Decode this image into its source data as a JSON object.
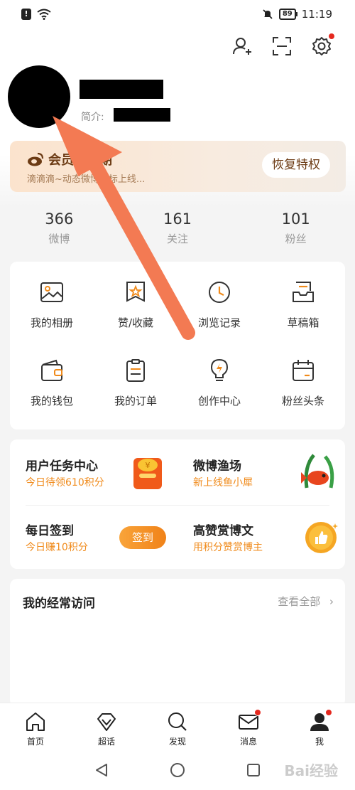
{
  "status": {
    "battery": "89",
    "time": "11:19"
  },
  "profile": {
    "bio_label": "简介:"
  },
  "member": {
    "title": "会员已过期",
    "subtitle": "滴滴滴~动态微博图标上线...",
    "button": "恢复特权"
  },
  "stats": [
    {
      "value": "366",
      "label": "微博"
    },
    {
      "value": "161",
      "label": "关注"
    },
    {
      "value": "101",
      "label": "粉丝"
    }
  ],
  "grid": [
    {
      "label": "我的相册",
      "icon": "album-icon"
    },
    {
      "label": "赞/收藏",
      "icon": "favorite-icon"
    },
    {
      "label": "浏览记录",
      "icon": "history-icon"
    },
    {
      "label": "草稿箱",
      "icon": "drafts-icon"
    },
    {
      "label": "我的钱包",
      "icon": "wallet-icon"
    },
    {
      "label": "我的订单",
      "icon": "orders-icon"
    },
    {
      "label": "创作中心",
      "icon": "creator-icon"
    },
    {
      "label": "粉丝头条",
      "icon": "fans-headline-icon"
    }
  ],
  "tasks": {
    "task_center": {
      "title": "用户任务中心",
      "sub": "今日待领610积分"
    },
    "fishing": {
      "title": "微博渔场",
      "sub": "新上线鱼小犀"
    },
    "checkin": {
      "title": "每日签到",
      "sub": "今日赚10积分",
      "button": "签到"
    },
    "reward": {
      "title": "高赞赏博文",
      "sub": "用积分赞赏博主"
    }
  },
  "visits": {
    "title": "我的经常访问",
    "view_all": "查看全部"
  },
  "nav": [
    {
      "label": "首页",
      "icon": "home-icon"
    },
    {
      "label": "超话",
      "icon": "super-topic-icon"
    },
    {
      "label": "发现",
      "icon": "discover-icon"
    },
    {
      "label": "消息",
      "icon": "message-icon"
    },
    {
      "label": "我",
      "icon": "me-icon"
    }
  ],
  "colors": {
    "accent": "#f08a1a",
    "annotation_arrow": "#f37a53",
    "badge": "#e5281e"
  }
}
